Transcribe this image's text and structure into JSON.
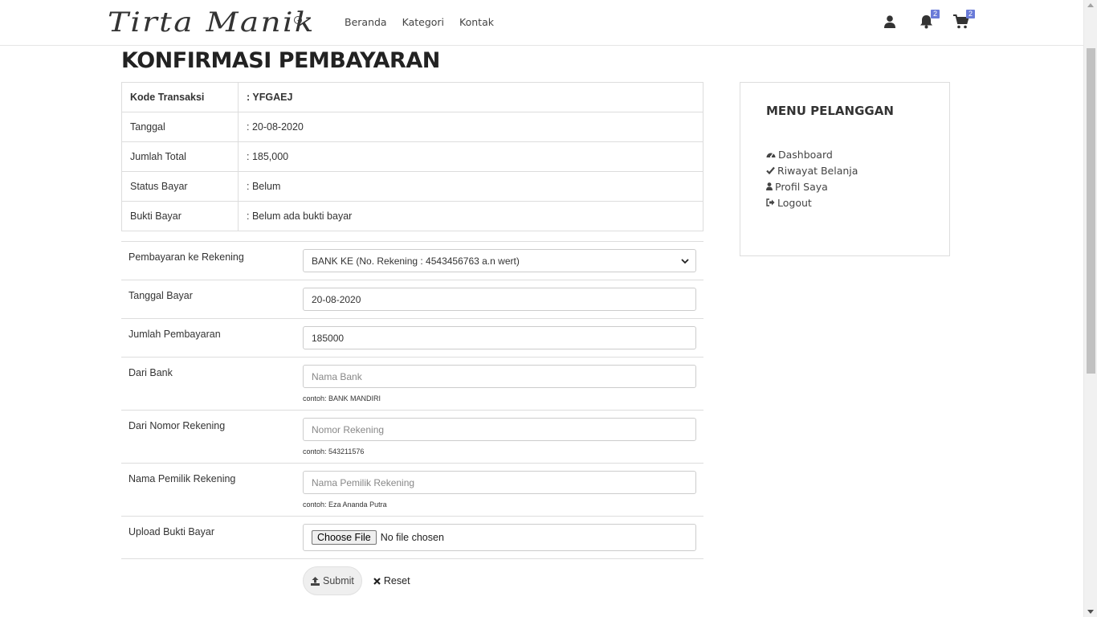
{
  "header": {
    "logo_text": "Tirta Manik",
    "nav": [
      "Beranda",
      "Kategori",
      "Kontak"
    ],
    "icons": [
      "user-icon",
      "bell-icon",
      "cart-icon"
    ],
    "notification_count": "2",
    "cart_count": "2",
    "accent_color": "#6a7bd8"
  },
  "page": {
    "title": "KONFIRMASI PEMBAYARAN"
  },
  "info_table": [
    {
      "label": "Kode Transaksi",
      "value": ": YFGAEJ"
    },
    {
      "label": "Tanggal",
      "value": ": 20-08-2020"
    },
    {
      "label": "Jumlah Total",
      "value": ": 185,000"
    },
    {
      "label": "Status Bayar",
      "value": ": Belum"
    },
    {
      "label": "Bukti Bayar",
      "value": ": Belum ada bukti bayar"
    }
  ],
  "form": {
    "rekening_label": "Pembayaran ke Rekening",
    "rekening_value": "BANK KE (No. Rekening : 4543456763 a.n wert)",
    "tanggal_label": "Tanggal Bayar",
    "tanggal_value": "20-08-2020",
    "jumlah_label": "Jumlah Pembayaran",
    "jumlah_value": "185000",
    "bank_label": "Dari Bank",
    "bank_placeholder": "Nama Bank",
    "bank_help": "contoh: BANK MANDIRI",
    "norek_label": "Dari Nomor Rekening",
    "norek_placeholder": "Nomor Rekening",
    "norek_help": "contoh: 543211576",
    "pemilik_label": "Nama Pemilik Rekening",
    "pemilik_placeholder": "Nama Pemilik Rekening",
    "pemilik_help": "contoh: Eza Ananda Putra",
    "upload_label": "Upload Bukti Bayar",
    "upload_button": "Choose File",
    "upload_status": "No file chosen",
    "submit_label": "Submit",
    "reset_label": "Reset"
  },
  "sidebar": {
    "title": "MENU PELANGGAN",
    "items": [
      {
        "label": "Dashboard",
        "icon": "dashboard-icon"
      },
      {
        "label": "Riwayat Belanja",
        "icon": "check-icon"
      },
      {
        "label": "Profil Saya",
        "icon": "user-icon"
      },
      {
        "label": "Logout",
        "icon": "logout-icon"
      }
    ]
  }
}
